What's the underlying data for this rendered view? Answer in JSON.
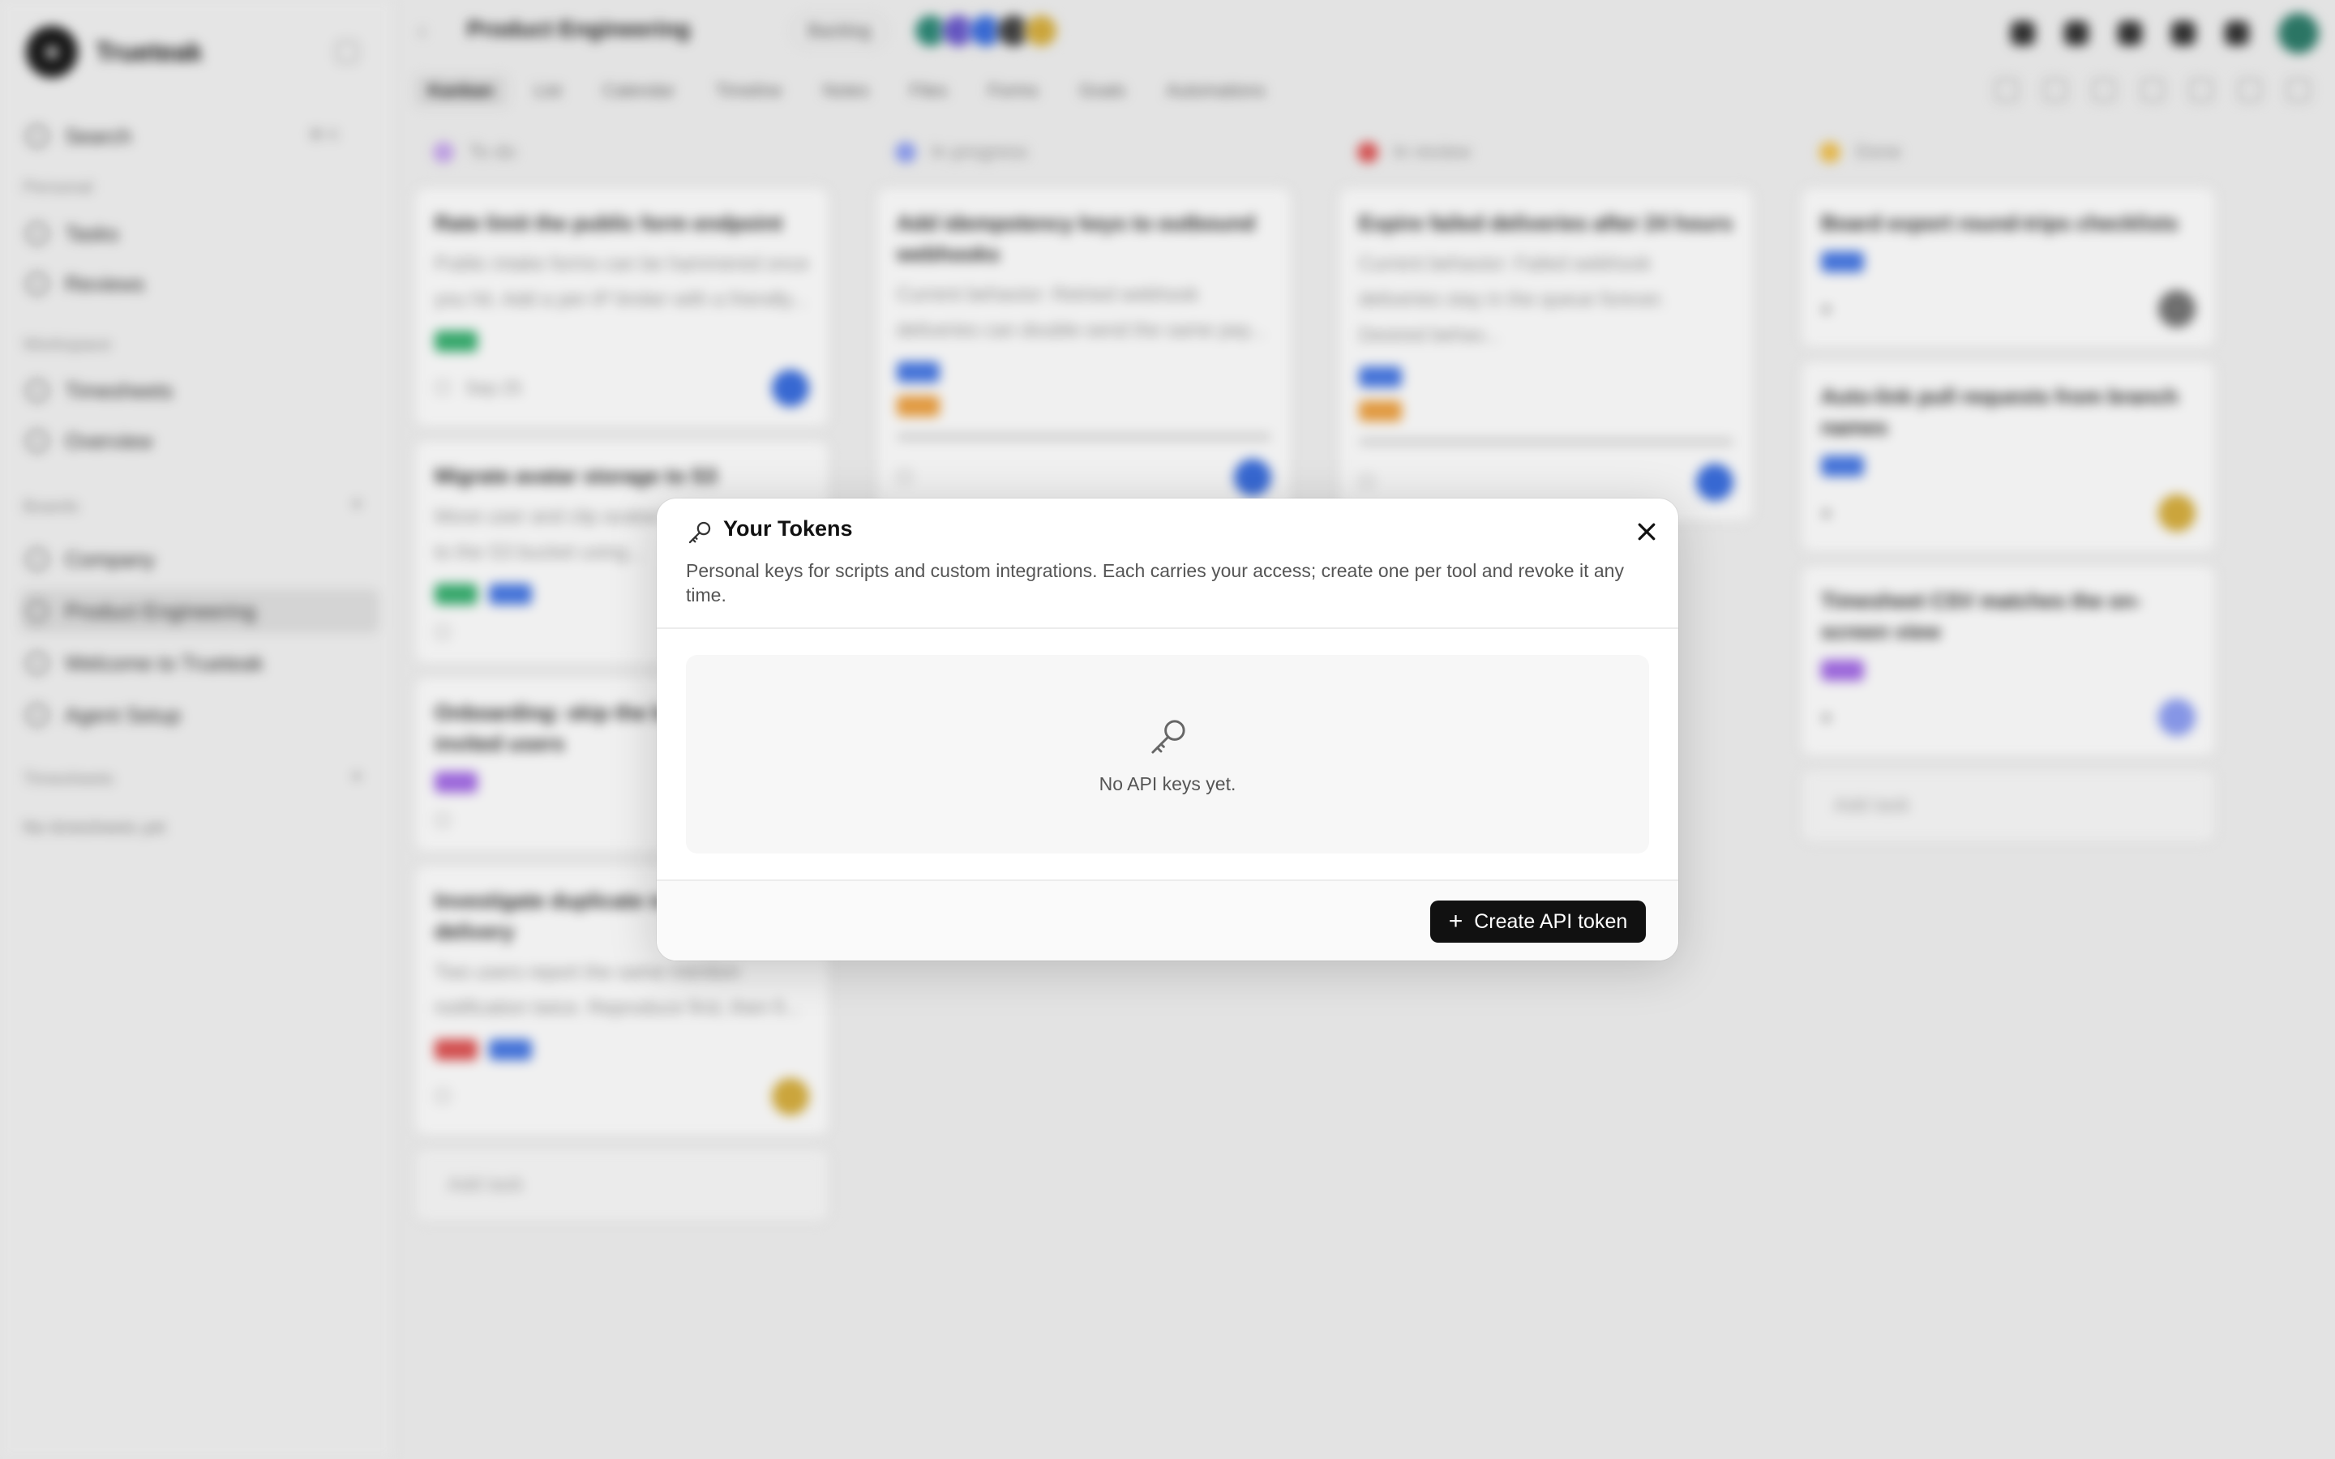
{
  "app": {
    "brand": "Trueteak",
    "sidebar": {
      "search": "Search",
      "personal_head": "Personal",
      "items_personal": [
        "Tasks",
        "Reviews"
      ],
      "workspace_head": "Workspace",
      "items_workspace": [
        "Timesheets",
        "Overview"
      ],
      "boards_head": "Boards",
      "items_boards": [
        "Company",
        "Product Engineering",
        "Welcome to Trueteak",
        "Agent Setup"
      ],
      "timesheets_head": "Timesheets",
      "timesheets_empty": "No timesheets yet"
    },
    "topbar": {
      "board_title": "Product Engineering",
      "status_chip": "Backlog"
    },
    "view_tabs": [
      "Kanban",
      "List",
      "Calendar",
      "Timeline",
      "Notes",
      "Files",
      "Forms",
      "Goals",
      "Automations"
    ],
    "columns": [
      {
        "name": "To do",
        "color": "#c9a8f0",
        "cards": [
          {
            "title": "Rate limit the public form endpoint",
            "desc": "Public intake forms can be hammered once you hit. Add a per-IP limiter with a friendly...",
            "tags": [
              "#3bb273"
            ],
            "due": "Sep 25",
            "avatar": "#3b6fe0"
          },
          {
            "title": "Migrate avatar storage to S3",
            "desc": "Move user and clip avatars from local disk to the S3 bucket using...",
            "tags": [
              "#3bb273",
              "#4a7be6"
            ],
            "due": "",
            "avatar": ""
          },
          {
            "title": "Onboarding: skip the board tour for invited users",
            "desc": "",
            "tags": [
              "#a66ee8"
            ],
            "due": "",
            "avatar": ""
          },
          {
            "title": "Investigate duplicate notification delivery",
            "desc": "Two users report the same mention notification twice. Reproduce first, then fi...",
            "tags": [
              "#e05555",
              "#4a7be6"
            ],
            "due": "",
            "avatar": "#d8b040"
          }
        ]
      },
      {
        "name": "In progress",
        "color": "#8fa0f5",
        "cards": [
          {
            "title": "Add idempotency keys to outbound webhooks",
            "desc": "Current behavior: Retried webhook deliveries can double-send the same pay...",
            "tags": [
              "#4a7be6",
              "#f0a445"
            ],
            "due": "",
            "avatar": "#3b6fe0"
          }
        ]
      },
      {
        "name": "In review",
        "color": "#e05555",
        "cards": [
          {
            "title": "Expire failed deliveries after 24 hours",
            "desc": "Current behavior: Failed webhook deliveries stay in the queue forever. Desired behav...",
            "tags": [
              "#4a7be6",
              "#f0a445"
            ],
            "due": "",
            "avatar": "#3b6fe0"
          }
        ]
      },
      {
        "name": "Done",
        "color": "#f2c14e",
        "cards": [
          {
            "title": "Board export round-trips checklists",
            "desc": "",
            "tags": [
              "#4a7be6"
            ],
            "due": "",
            "avatar": "#777"
          },
          {
            "title": "Auto-link pull requests from branch names",
            "desc": "",
            "tags": [
              "#4a7be6"
            ],
            "due": "",
            "avatar": "#d8b040"
          },
          {
            "title": "Timesheet CSV matches the on-screen view",
            "desc": "",
            "tags": [
              "#a66ee8"
            ],
            "due": "",
            "avatar": "#8fa0f5"
          }
        ]
      }
    ],
    "add_task": "Add task"
  },
  "dialog": {
    "title": "Your Tokens",
    "description": "Personal keys for scripts and custom integrations. Each carries your access; create one per tool and revoke it any time.",
    "empty_text": "No API keys yet.",
    "create_button": "Create API token",
    "key_icon": "key-icon",
    "close_icon": "close-icon"
  }
}
